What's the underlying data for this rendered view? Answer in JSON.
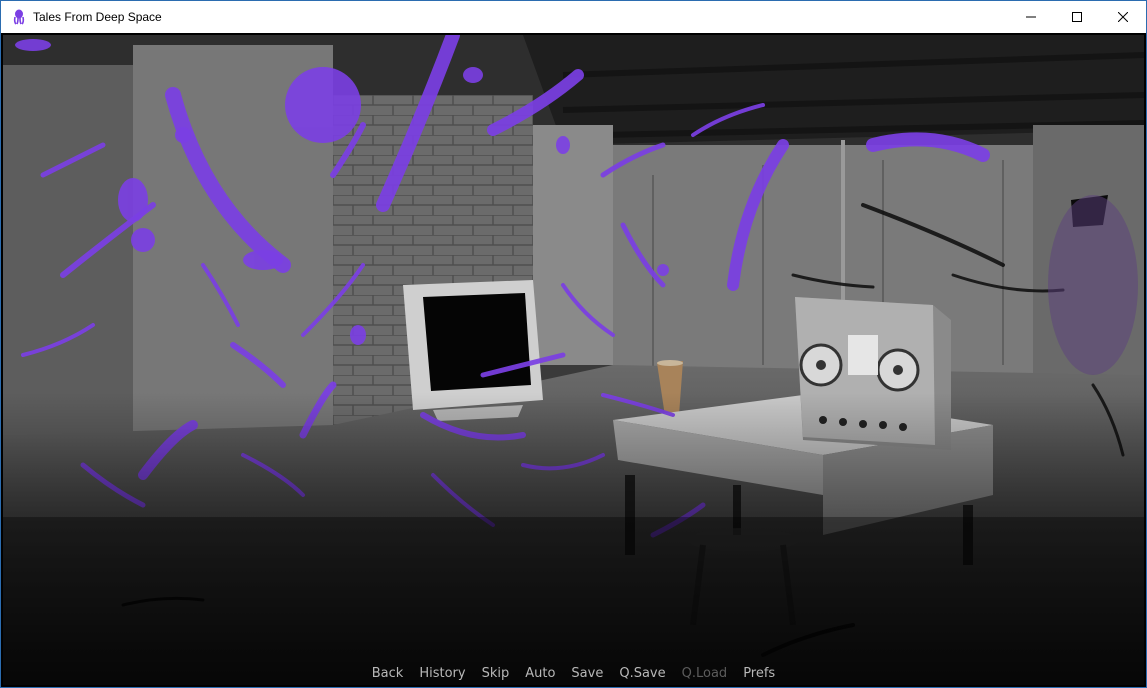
{
  "window": {
    "title": "Tales From Deep Space",
    "icon": "purple-creature-icon",
    "controls": [
      "minimize-icon",
      "maximize-icon",
      "close-icon"
    ]
  },
  "scene": {
    "description_icon": "basement-scene",
    "accent_color": "#7b3fe4"
  },
  "quick_menu": {
    "back": "Back",
    "history": "History",
    "skip": "Skip",
    "auto": "Auto",
    "save": "Save",
    "qsave": "Q.Save",
    "qload": "Q.Load",
    "prefs": "Prefs"
  }
}
